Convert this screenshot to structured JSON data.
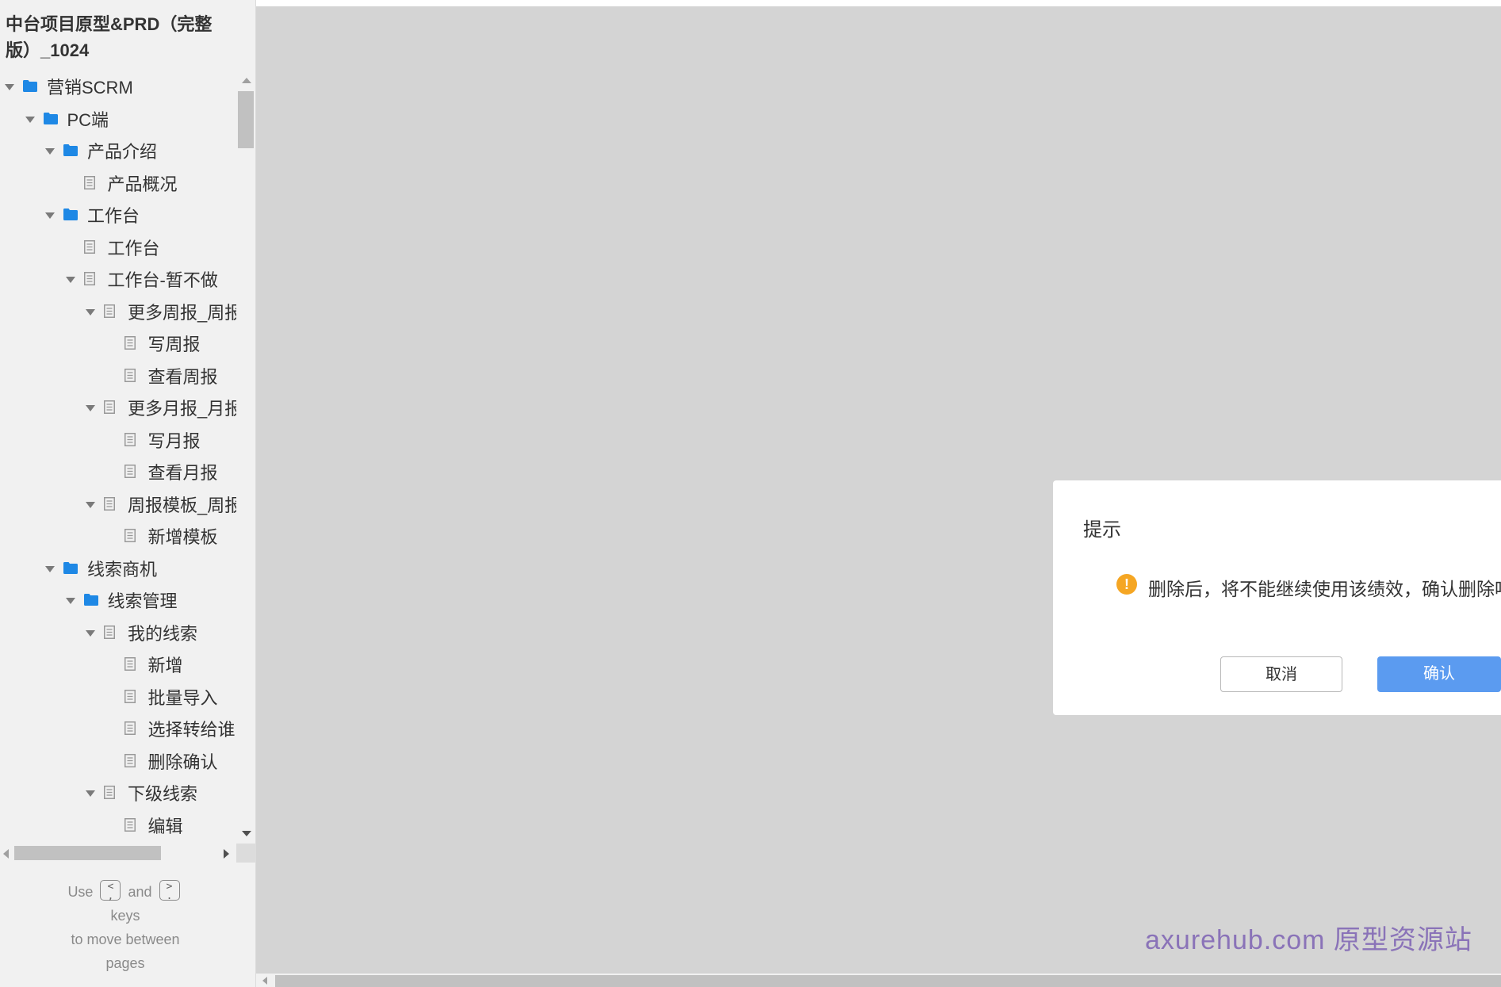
{
  "sidebar": {
    "project_title": "中台项目原型&PRD（完整版）_1024",
    "tree": [
      {
        "label": "营销SCRM",
        "type": "folder",
        "expanded": true,
        "level": 0
      },
      {
        "label": "PC端",
        "type": "folder",
        "expanded": true,
        "level": 1
      },
      {
        "label": "产品介绍",
        "type": "folder",
        "expanded": true,
        "level": 2
      },
      {
        "label": "产品概况",
        "type": "page",
        "expanded": null,
        "level": 3
      },
      {
        "label": "工作台",
        "type": "folder",
        "expanded": true,
        "level": 2
      },
      {
        "label": "工作台",
        "type": "page",
        "expanded": null,
        "level": 3
      },
      {
        "label": "工作台-暂不做",
        "type": "page",
        "expanded": true,
        "level": 3
      },
      {
        "label": "更多周报_周报",
        "type": "page",
        "expanded": true,
        "level": 4
      },
      {
        "label": "写周报",
        "type": "page",
        "expanded": null,
        "level": 5
      },
      {
        "label": "查看周报",
        "type": "page",
        "expanded": null,
        "level": 5
      },
      {
        "label": "更多月报_月报",
        "type": "page",
        "expanded": true,
        "level": 4
      },
      {
        "label": "写月报",
        "type": "page",
        "expanded": null,
        "level": 5
      },
      {
        "label": "查看月报",
        "type": "page",
        "expanded": null,
        "level": 5
      },
      {
        "label": "周报模板_周报",
        "type": "page",
        "expanded": true,
        "level": 4
      },
      {
        "label": "新增模板",
        "type": "page",
        "expanded": null,
        "level": 5
      },
      {
        "label": "线索商机",
        "type": "folder",
        "expanded": true,
        "level": 2
      },
      {
        "label": "线索管理",
        "type": "folder",
        "expanded": true,
        "level": 3
      },
      {
        "label": "我的线索",
        "type": "page",
        "expanded": true,
        "level": 4
      },
      {
        "label": "新增",
        "type": "page",
        "expanded": null,
        "level": 5
      },
      {
        "label": "批量导入",
        "type": "page",
        "expanded": null,
        "level": 5
      },
      {
        "label": "选择转给谁",
        "type": "page",
        "expanded": null,
        "level": 5
      },
      {
        "label": "删除确认",
        "type": "page",
        "expanded": null,
        "level": 5
      },
      {
        "label": "下级线索",
        "type": "page",
        "expanded": true,
        "level": 4
      },
      {
        "label": "编辑",
        "type": "page",
        "expanded": null,
        "level": 5
      }
    ],
    "hint": {
      "use": "Use",
      "and": "and",
      "keys": "keys",
      "move": "to move between",
      "pages": "pages",
      "prev_key": "<\n,",
      "next_key": ">\n."
    }
  },
  "dialog": {
    "title": "提示",
    "message": "删除后，将不能继续使用该绩效，确认删除吗？",
    "cancel_label": "取消",
    "confirm_label": "确认",
    "warning_glyph": "!"
  },
  "watermark": "axurehub.com 原型资源站",
  "colors": {
    "folder_icon": "#1e88e5",
    "confirm_button": "#5b9bf0",
    "warning_icon": "#f5a623",
    "overlay": "#d4d4d4"
  }
}
